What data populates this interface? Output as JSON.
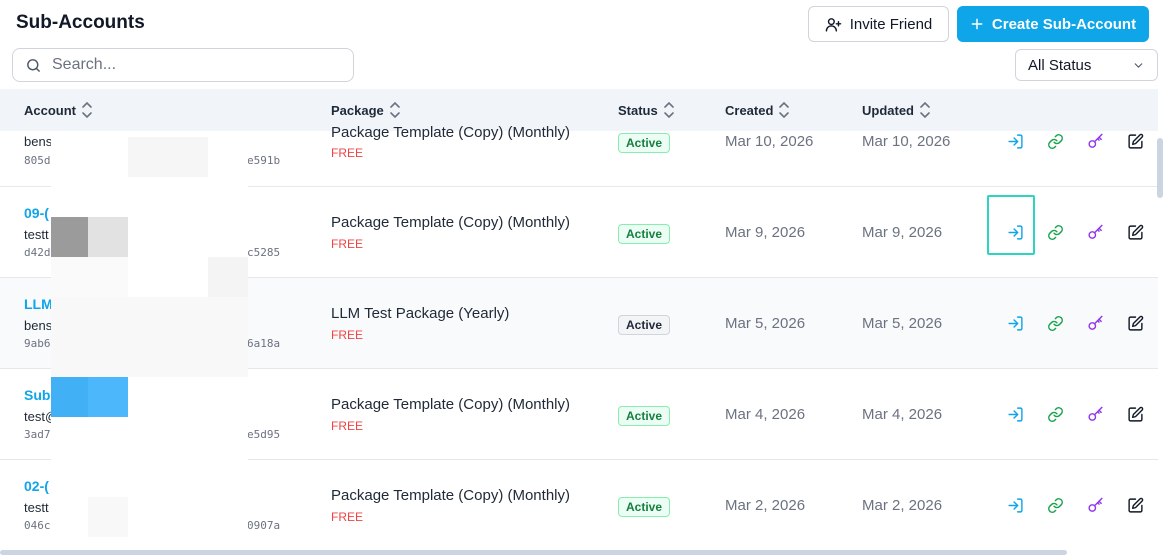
{
  "header": {
    "title": "Sub-Accounts",
    "invite_label": "Invite Friend",
    "create_label": "Create Sub-Account"
  },
  "search": {
    "placeholder": "Search...",
    "value": ""
  },
  "status_filter": {
    "selected": "All Status"
  },
  "columns": {
    "account": "Account",
    "package": "Package",
    "status": "Status",
    "created": "Created",
    "updated": "Updated"
  },
  "rows": [
    {
      "name": "",
      "email": "bens",
      "id_start": "805d",
      "id_end": "e591b",
      "package": "Package Template (Copy) (Monthly)",
      "price": "FREE",
      "status": "Active",
      "created": "Mar 10, 2026",
      "updated": "Mar 10, 2026"
    },
    {
      "name": "09-(",
      "email": "testt",
      "id_start": "d42d",
      "id_end": "c5285",
      "package": "Package Template (Copy) (Monthly)",
      "price": "FREE",
      "status": "Active",
      "created": "Mar 9, 2026",
      "updated": "Mar 9, 2026"
    },
    {
      "name": "LLM",
      "email": "bens",
      "id_start": "9ab6",
      "id_end": "6a18a",
      "package": "LLM Test Package (Yearly)",
      "price": "FREE",
      "status": "Active",
      "created": "Mar 5, 2026",
      "updated": "Mar 5, 2026"
    },
    {
      "name": "Sub",
      "email": "test@",
      "id_start": "3ad7",
      "id_end": "e5d95",
      "package": "Package Template (Copy) (Monthly)",
      "price": "FREE",
      "status": "Active",
      "created": "Mar 4, 2026",
      "updated": "Mar 4, 2026"
    },
    {
      "name": "02-(",
      "email": "testt",
      "id_start": "046c",
      "id_end": "0907a",
      "package": "Package Template (Copy) (Monthly)",
      "price": "FREE",
      "status": "Active",
      "created": "Mar 2, 2026",
      "updated": "Mar 2, 2026"
    }
  ],
  "icons": {
    "login": "login-icon",
    "link": "link-icon",
    "key": "key-icon",
    "edit": "edit-icon"
  },
  "colors": {
    "accent": "#0ea5e9",
    "active_green": "#15803d",
    "price_red": "#ef4444",
    "key_purple": "#9333ea",
    "link_green": "#16a34a",
    "focus_teal": "#2dd4bf"
  }
}
